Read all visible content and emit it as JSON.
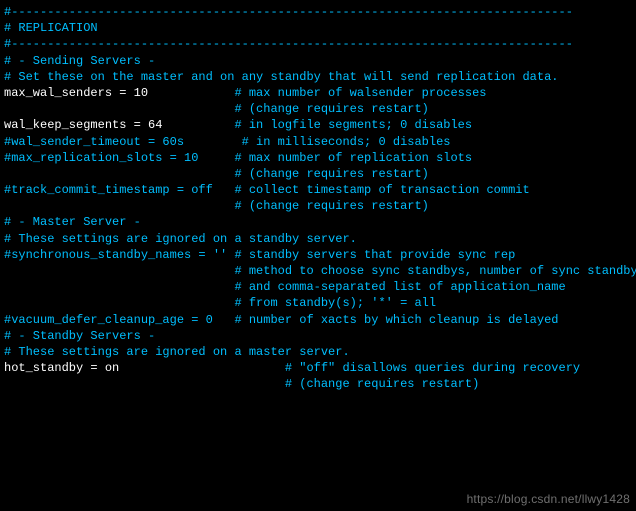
{
  "lines": {
    "l01": "#------------------------------------------------------------------------------",
    "l02": "# REPLICATION",
    "l03": "#------------------------------------------------------------------------------",
    "l04": "",
    "l05": "# - Sending Servers -",
    "l06": "",
    "l07": "# Set these on the master and on any standby that will send replication data.",
    "l08": "",
    "l09a": "max_wal_senders = 10",
    "l09b": "            # max number of walsender processes",
    "l10": "                                # (change requires restart)",
    "l11a": "wal_keep_segments = 64",
    "l11b": "          # in logfile segments; 0 disables",
    "l12": "#wal_sender_timeout = 60s        # in milliseconds; 0 disables",
    "l13": "",
    "l14": "#max_replication_slots = 10     # max number of replication slots",
    "l15": "                                # (change requires restart)",
    "l16": "#track_commit_timestamp = off   # collect timestamp of transaction commit",
    "l17": "                                # (change requires restart)",
    "l18": "",
    "l19": "",
    "l20": "# - Master Server -",
    "l21": "",
    "l22": "# These settings are ignored on a standby server.",
    "l23": "",
    "l24": "#synchronous_standby_names = '' # standby servers that provide sync rep",
    "l25": "                                # method to choose sync standbys, number of sync standbys,",
    "l26": "                                # and comma-separated list of application_name",
    "l27": "                                # from standby(s); '*' = all",
    "l28": "#vacuum_defer_cleanup_age = 0   # number of xacts by which cleanup is delayed",
    "l29": "",
    "l30": "# - Standby Servers -",
    "l31": "",
    "l32": "# These settings are ignored on a master server.",
    "l33": "",
    "l34a": "hot_standby = on",
    "l34b": "                       # \"off\" disallows queries during recovery",
    "l35": "                                       # (change requires restart)"
  },
  "watermark": "https://blog.csdn.net/llwy1428"
}
